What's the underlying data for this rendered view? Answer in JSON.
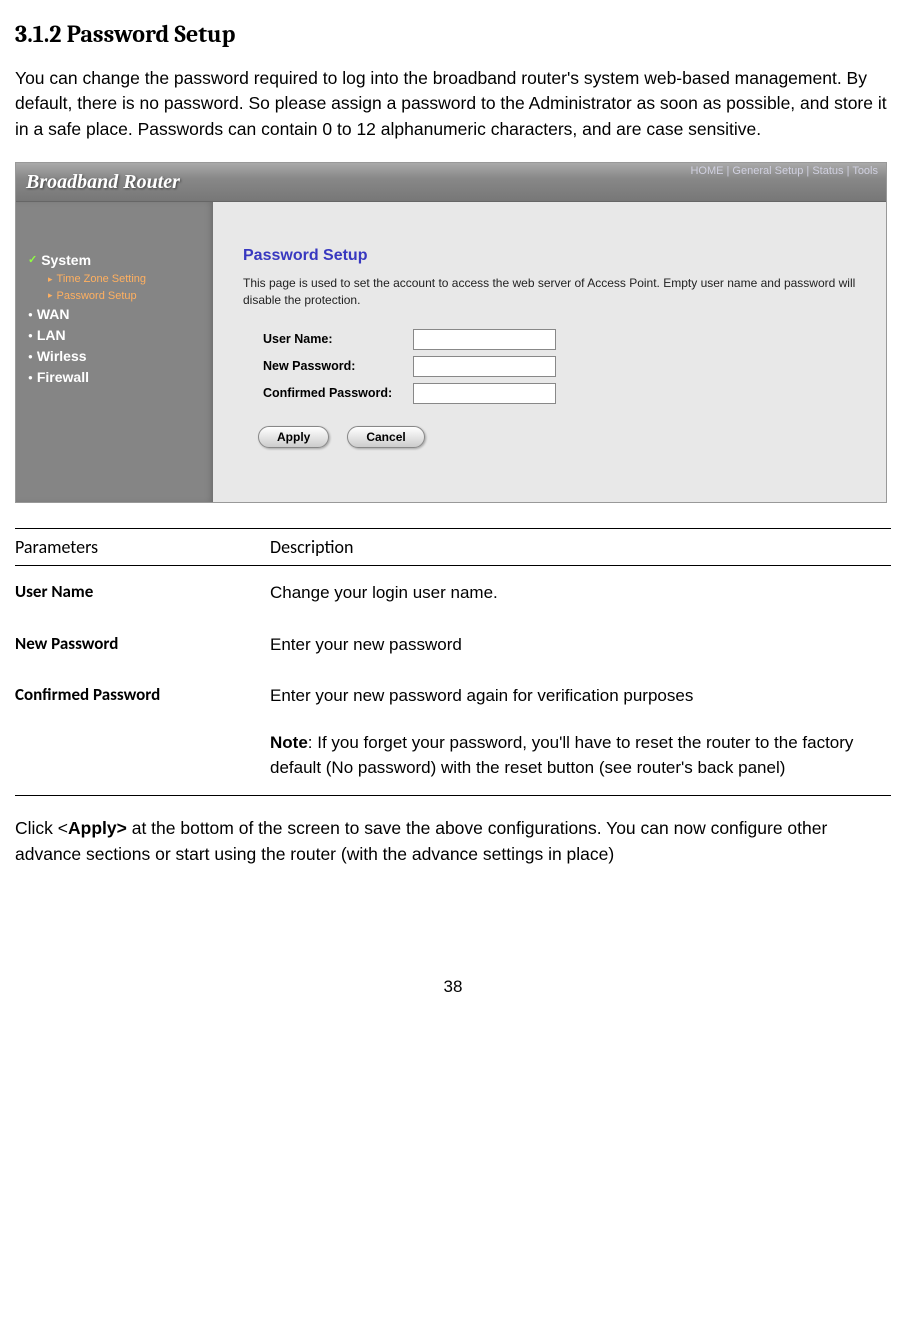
{
  "doc": {
    "heading": "3.1.2 Password Setup",
    "intro": "You can change the password required to log into the broadband router's system web-based management. By default, there is no password. So please assign a password to the Administrator as soon as possible, and store it in a safe place. Passwords can contain 0 to 12 alphanumeric characters, and are case sensitive.",
    "table_header": {
      "col1": "Parameters",
      "col2": "Description"
    },
    "rows": [
      {
        "name": "User Name",
        "desc": "Change your login user name."
      },
      {
        "name": "New Password",
        "desc": "Enter your new password"
      },
      {
        "name": "Confirmed Password",
        "desc": "Enter your new password again for verification purposes"
      }
    ],
    "note_label": "Note",
    "note_body": ": If you forget your password, you'll have to reset the router to the factory default (No password) with the reset button (see router's back panel)",
    "closing_pre": "Click <",
    "closing_bold": "Apply>",
    "closing_post": " at the bottom of the screen to save the above configurations. You can now configure other advance sections or start using the router (with the advance settings in place)",
    "page_num": "38"
  },
  "router": {
    "brand": "Broadband Router",
    "topnav": {
      "home": "HOME",
      "setup": "General Setup",
      "status": "Status",
      "tools": "Tools",
      "sep": " | "
    },
    "sidebar": {
      "system": "System",
      "tz": "Time Zone Setting",
      "pw": "Password Setup",
      "wan": "WAN",
      "lan": "LAN",
      "wireless": "Wirless",
      "firewall": "Firewall"
    },
    "panel": {
      "title": "Password Setup",
      "desc": "This page is used to set the account to access the web server of Access Point. Empty user name and password will disable the protection.",
      "labels": {
        "user": "User Name:",
        "newpw": "New Password:",
        "confpw": "Confirmed Password:"
      },
      "values": {
        "user": "",
        "newpw": "",
        "confpw": ""
      },
      "buttons": {
        "apply": "Apply",
        "cancel": "Cancel"
      }
    }
  }
}
